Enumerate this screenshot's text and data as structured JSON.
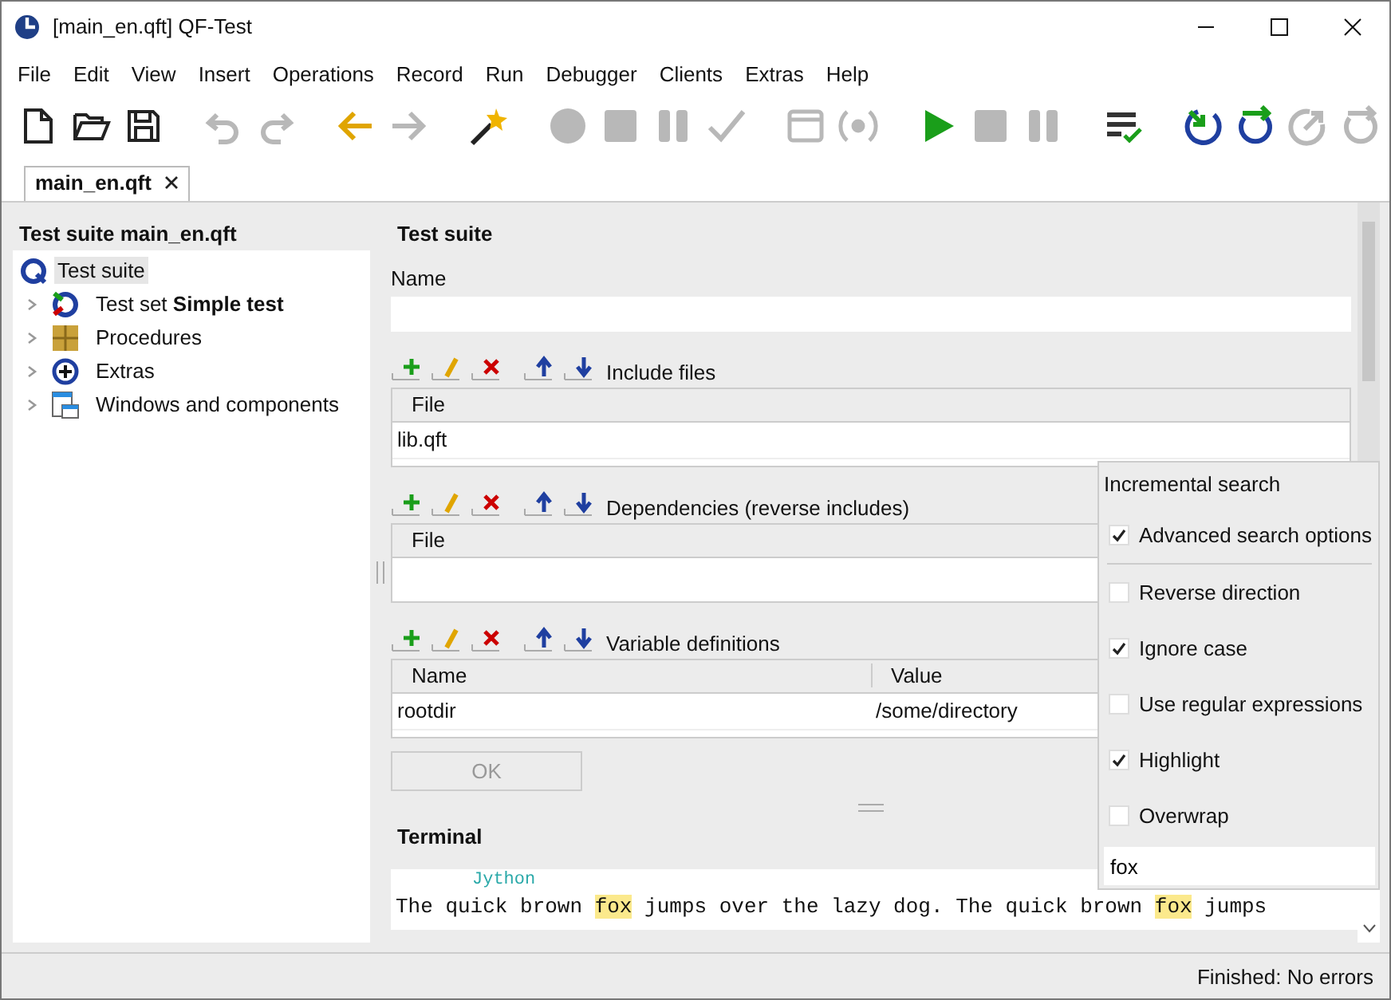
{
  "window": {
    "title": "[main_en.qft] QF-Test"
  },
  "menu": [
    "File",
    "Edit",
    "View",
    "Insert",
    "Operations",
    "Record",
    "Run",
    "Debugger",
    "Clients",
    "Extras",
    "Help"
  ],
  "toolbar": [
    {
      "kind": "new",
      "disabled": false
    },
    {
      "kind": "open",
      "disabled": false
    },
    {
      "kind": "save",
      "disabled": false
    },
    {
      "kind": "sep"
    },
    {
      "kind": "undo",
      "disabled": true
    },
    {
      "kind": "redo",
      "disabled": true
    },
    {
      "kind": "sep"
    },
    {
      "kind": "back",
      "disabled": false
    },
    {
      "kind": "forward",
      "disabled": true
    },
    {
      "kind": "sep"
    },
    {
      "kind": "wand",
      "disabled": false
    },
    {
      "kind": "sep"
    },
    {
      "kind": "record",
      "disabled": true
    },
    {
      "kind": "stop",
      "disabled": true
    },
    {
      "kind": "pause",
      "disabled": true
    },
    {
      "kind": "check",
      "disabled": true
    },
    {
      "kind": "sep"
    },
    {
      "kind": "window",
      "disabled": true
    },
    {
      "kind": "signal",
      "disabled": true
    },
    {
      "kind": "sep"
    },
    {
      "kind": "play",
      "disabled": false
    },
    {
      "kind": "stop",
      "disabled": true
    },
    {
      "kind": "pause",
      "disabled": true
    },
    {
      "kind": "sep"
    },
    {
      "kind": "list",
      "disabled": false
    },
    {
      "kind": "sep"
    },
    {
      "kind": "stepin",
      "disabled": false
    },
    {
      "kind": "stepover",
      "disabled": false
    },
    {
      "kind": "stepout",
      "disabled": true
    },
    {
      "kind": "stepover",
      "disabled": true
    }
  ],
  "tabs": [
    {
      "label": "main_en.qft",
      "selected": true
    }
  ],
  "tree": {
    "title": "Test suite main_en.qft",
    "root": {
      "label": "Test suite",
      "selected": true,
      "kind": "suite",
      "children": [
        {
          "label": "Test set **Simple test**",
          "kind": "testset",
          "expanded": false
        },
        {
          "label": "Procedures",
          "kind": "procedures",
          "expanded": false
        },
        {
          "label": "Extras",
          "kind": "extras",
          "expanded": false
        },
        {
          "label": "Windows and components",
          "kind": "windows",
          "expanded": false
        }
      ]
    }
  },
  "detail": {
    "title": "Test suite",
    "name_label": "Name",
    "include_files": {
      "label": "Include files",
      "columns": [
        "File"
      ],
      "rows": [
        [
          "lib.qft"
        ]
      ]
    },
    "dependencies": {
      "label": "Dependencies (reverse includes)",
      "columns": [
        "File"
      ]
    },
    "variables": {
      "label": "Variable definitions",
      "columns": [
        "Name",
        "Value"
      ],
      "rows": [
        [
          "rootdir",
          "/some/directory"
        ]
      ]
    },
    "ok_button": {
      "label": "OK",
      "disabled": true
    }
  },
  "search_popup": {
    "title": "Incremental search",
    "advanced": {
      "label": "Advanced search options",
      "checked": true
    },
    "options": [
      {
        "label": "Reverse direction",
        "checked": false
      },
      {
        "label": "Ignore case",
        "checked": true
      },
      {
        "label": "Use regular expressions",
        "checked": false
      },
      {
        "label": "Highlight",
        "checked": true
      },
      {
        "label": "Overwrap",
        "checked": false
      }
    ],
    "query": "fox"
  },
  "terminal": {
    "title": "Terminal",
    "prompt": "Jython",
    "line": [
      {
        "text": "The quick brown ",
        "match": false
      },
      {
        "text": "fox",
        "match": true
      },
      {
        "text": " jumps over the lazy dog. The quick brown ",
        "match": false
      },
      {
        "text": "fox",
        "match": true
      },
      {
        "text": " jumps",
        "match": false
      }
    ]
  },
  "status_bar": "Finished: No errors"
}
